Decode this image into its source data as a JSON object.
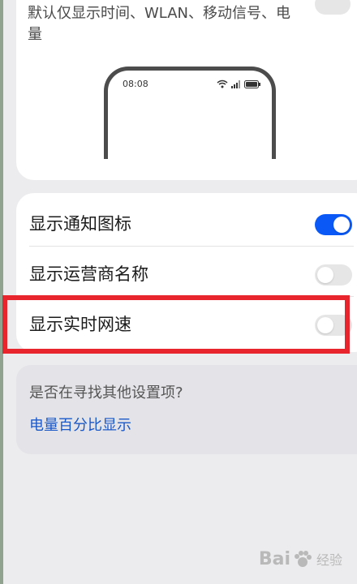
{
  "top_card": {
    "description_partial": "默认仅显示时间、WLAN、移动信号、电量",
    "preview_time": "08:08"
  },
  "list": {
    "items": [
      {
        "label": "显示通知图标",
        "enabled": true
      },
      {
        "label": "显示运营商名称",
        "enabled": false
      },
      {
        "label": "显示实时网速",
        "enabled": false
      }
    ]
  },
  "search_suggest": {
    "question": "是否在寻找其他设置项?",
    "link": "电量百分比显示"
  },
  "watermark": {
    "brand_left": "Bai",
    "brand_right": "经验"
  },
  "colors": {
    "accent": "#0a59f7",
    "highlight": "#e8242c",
    "link": "#1a58c8"
  }
}
